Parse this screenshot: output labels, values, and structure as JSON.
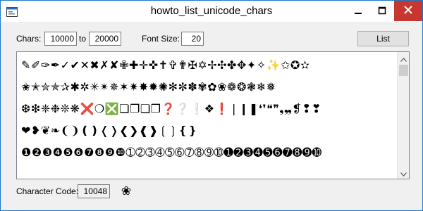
{
  "window": {
    "title": "howto_list_unicode_chars",
    "icon": "window-form-icon",
    "controls": [
      "minimize-icon",
      "maximize-icon",
      "close-icon"
    ]
  },
  "form": {
    "chars_label": "Chars:",
    "from_value": "10000",
    "to_label": "to",
    "to_value": "20000",
    "font_size_label": "Font Size:",
    "font_size_value": "20",
    "list_button": "List"
  },
  "characters": {
    "rows": [
      "✎✐✑✒✓✔✕✖✗✘✙✚✛✜✝✞✟✠✡✢✣✤✥✦✧✨✩✪✫",
      "✬✭✮✯✰✱✲✳✴✵✶✷✸✹✺✻✼✽✾✿❀❁❂❃❄❅",
      "❆❇❈❉❊❋❌❍❎❏❐❑❒❓❔❕❖❗❘❙❚❛❜❝❞❟❠❡❢❣",
      "❤❥❦❧❨❩❪❫❬❭❮❯❰❱❲❳❴❵",
      "❶❷❸❹❺❻❼❽❾❿➀➁➂➃➄➅➆➇➈➉➊➋➌➍➎➏➐➑➒➓"
    ]
  },
  "footer": {
    "code_label": "Character Code:",
    "code_value": "10048",
    "code_char": "❀"
  },
  "colors": {
    "title_bar": "#ffffff",
    "window_border": "#1979ca",
    "form_background": "#f0f0f0",
    "close_button": "#c7372f"
  }
}
